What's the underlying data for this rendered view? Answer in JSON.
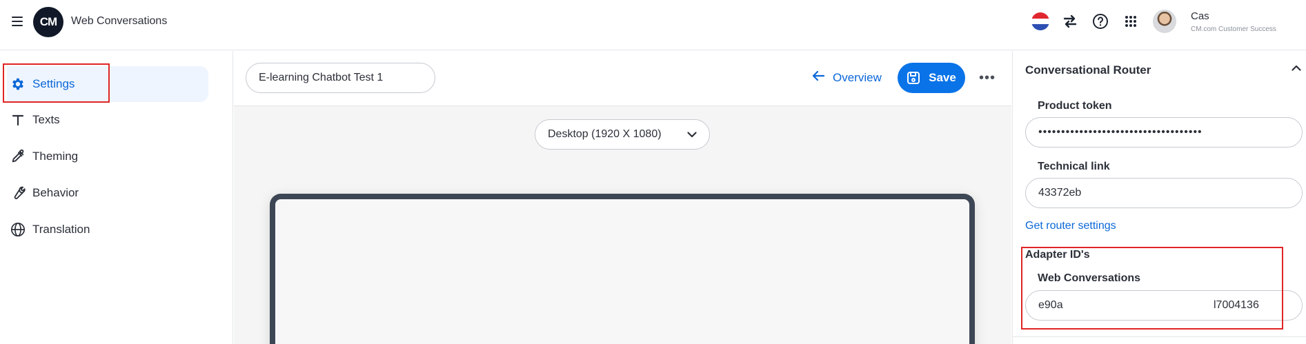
{
  "header": {
    "logo_text": "CM",
    "app_title": "Web Conversations",
    "user_name": "Cas",
    "user_role": "CM.com Customer Success",
    "icons": [
      "menu-icon",
      "flag-netherlands-icon",
      "switch-arrows-icon",
      "help-icon",
      "apps-grid-icon"
    ]
  },
  "sidebar": {
    "items": [
      {
        "label": "Settings",
        "icon": "gear-icon",
        "active": true
      },
      {
        "label": "Texts",
        "icon": "text-icon",
        "active": false
      },
      {
        "label": "Theming",
        "icon": "eyedropper-icon",
        "active": false
      },
      {
        "label": "Behavior",
        "icon": "wrench-icon",
        "active": false
      },
      {
        "label": "Translation",
        "icon": "globe-icon",
        "active": false
      }
    ]
  },
  "toolbar": {
    "chatbot_name": "E-learning Chatbot Test 1",
    "overview_label": "Overview",
    "save_label": "Save",
    "more_label": "•••"
  },
  "preview": {
    "device": "Desktop (1920 X 1080)"
  },
  "panel": {
    "title": "Conversational Router",
    "product_token_label": "Product token",
    "product_token_value": "••••••••••••••••••••••••••••••••••••",
    "technical_link_label": "Technical link",
    "technical_link_value": "43372eb",
    "router_link": "Get router settings",
    "adapter_section": "Adapter ID's",
    "web_conversations_label": "Web Conversations",
    "adapter_value_start": "e90a",
    "adapter_value_end": "l7004136"
  },
  "colors": {
    "accent": "#0a73e8",
    "link": "#0a67d8",
    "highlight": "#e02424",
    "active_bg": "#eef5fe"
  }
}
